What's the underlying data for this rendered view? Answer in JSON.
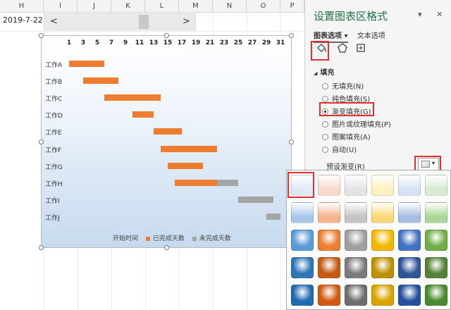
{
  "sheet": {
    "columns": [
      "H",
      "I",
      "J",
      "K",
      "L",
      "M",
      "N",
      "O",
      "P"
    ],
    "date_cell": "2019-7-22",
    "scroll_left": "<",
    "scroll_right": ">"
  },
  "chart_data": {
    "type": "bar",
    "orientation": "horizontal-gantt",
    "x_ticks": [
      "1",
      "3",
      "5",
      "7",
      "9",
      "11",
      "13",
      "15",
      "17",
      "19",
      "21",
      "23",
      "25",
      "27",
      "29",
      "31"
    ],
    "xlim": [
      1,
      31
    ],
    "categories": [
      "工作A",
      "工作B",
      "工作C",
      "工作D",
      "工作E",
      "工作F",
      "工作G",
      "工作H",
      "工作I",
      "工作J"
    ],
    "series": [
      {
        "name": "开始时间",
        "values": [
          1,
          3,
          6,
          10,
          13,
          14,
          15,
          16,
          25,
          29
        ],
        "color": "transparent"
      },
      {
        "name": "已完成天数",
        "values": [
          5,
          5,
          8,
          3,
          4,
          8,
          5,
          6,
          0,
          0
        ],
        "color": "#ed7d31"
      },
      {
        "name": "未完成天数",
        "values": [
          0,
          0,
          0,
          0,
          0,
          0,
          0,
          3,
          5,
          2
        ],
        "color": "#a5a5a5"
      }
    ],
    "legend": "bottom"
  },
  "pane": {
    "title": "设置图表区格式",
    "dropdown": "▾",
    "close": "✕",
    "tabs": [
      "图表选项",
      "文本选项"
    ],
    "tab_caret": "▾",
    "icons": [
      "fill-bucket-icon",
      "pentagon-icon",
      "size-icon"
    ],
    "section": "填充",
    "section_caret": "◢",
    "options": [
      "无填充(N)",
      "纯色填充(S)",
      "渐变填充(G)",
      "图片或纹理填充(P)",
      "图案填充(A)",
      "自动(U)"
    ],
    "selected_option": "渐变填充(G)",
    "preset_label": "预设渐变(R)"
  },
  "gallery": {
    "colors": {
      "highlight": "#e03131"
    }
  }
}
